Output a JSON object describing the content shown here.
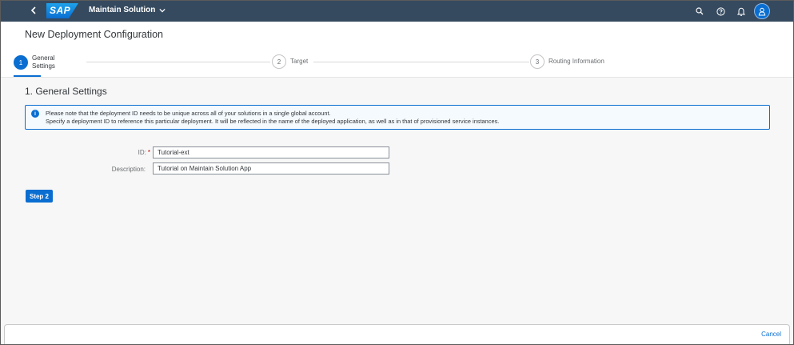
{
  "shell": {
    "logo_text": "SAP",
    "app_title": "Maintain Solution",
    "icons": [
      "search-icon",
      "help-icon",
      "bell-icon",
      "user-icon"
    ]
  },
  "header": {
    "title": "New Deployment Configuration",
    "steps": [
      {
        "number": "1",
        "label": "General Settings",
        "active": true
      },
      {
        "number": "2",
        "label": "Target",
        "active": false
      },
      {
        "number": "3",
        "label": "Routing Information",
        "active": false
      }
    ]
  },
  "content": {
    "section_title": "1. General Settings",
    "info": {
      "line1": "Please note that the deployment ID needs to be unique across all of your solutions in a single global account.",
      "line2": "Specify a deployment ID to reference this particular deployment. It will be reflected in the name of the deployed application, as well as in that of provisioned service instances."
    },
    "form": {
      "id_label": "ID:",
      "id_required": "*",
      "id_value": "Tutorial-ext",
      "description_label": "Description:",
      "description_value": "Tutorial on Maintain Solution App"
    },
    "step2_label": "Step 2"
  },
  "footer": {
    "cancel_label": "Cancel"
  },
  "colors": {
    "shell": "#354a5f",
    "accent": "#0a6ed1",
    "required": "#bb0000"
  }
}
